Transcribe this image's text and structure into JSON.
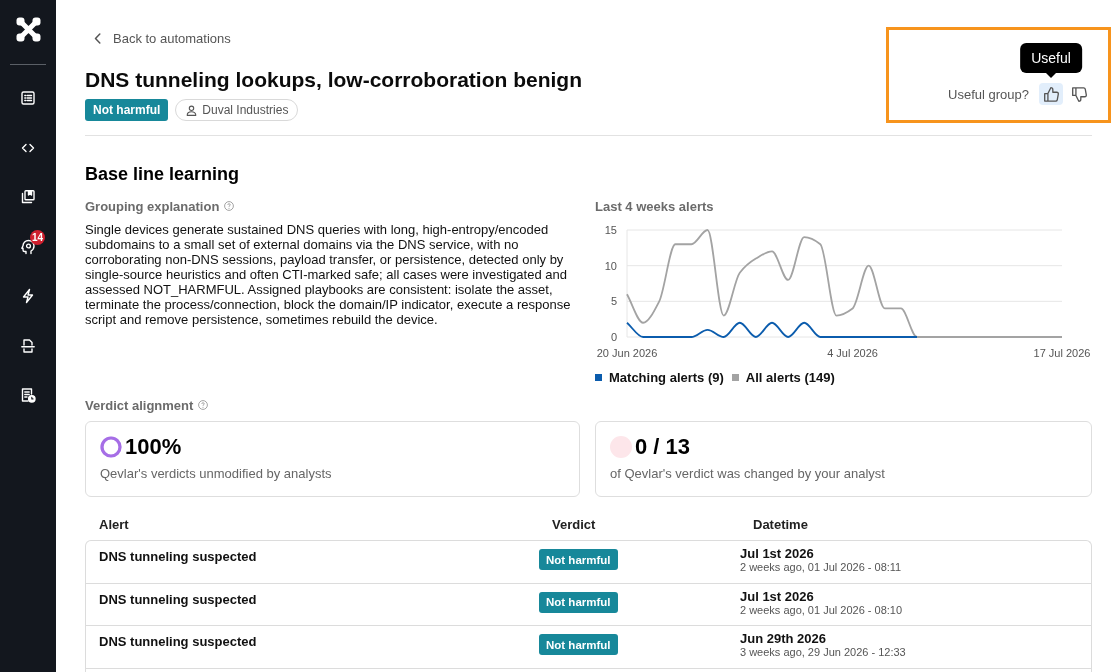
{
  "sidebar": {
    "items": [
      {
        "kind": "list"
      },
      {
        "kind": "code"
      },
      {
        "kind": "library"
      },
      {
        "kind": "head",
        "badge": "14"
      },
      {
        "kind": "bolt"
      },
      {
        "kind": "scan"
      },
      {
        "kind": "report"
      }
    ]
  },
  "header": {
    "back_link": "Back to automations",
    "title": "DNS tunneling lookups, low-corroboration benign",
    "tags": [
      {
        "kind": "verdict",
        "label": "Not harmful"
      },
      {
        "kind": "client",
        "label": "Duval Industries"
      }
    ]
  },
  "feedback": {
    "highlighted": true,
    "label": "Useful group?",
    "buttons": [
      {
        "kind": "up",
        "selected": true,
        "tooltip": "Useful"
      },
      {
        "kind": "down",
        "selected": false
      }
    ]
  },
  "section": {
    "title": "Base line learning",
    "explanation": {
      "label": "Grouping explanation",
      "text": "Single devices generate sustained DNS queries with long, high-entropy/encoded subdomains to a small set of external domains via the DNS service, with no corroborating non-DNS sessions, payload transfer, or persistence, detected only by single-source heuristics and often CTI-marked safe; all cases were investigated and assessed NOT_HARMFUL. Assigned playbooks are consistent: isolate the asset, terminate the process/connection, block the domain/IP indicator, execute a response script and remove persistence, sometimes rebuild the device."
    },
    "chart": {
      "chart_data": {
        "type": "line",
        "title": "Last 4 weeks alerts",
        "categories": [
          "20 Jun 2026",
          null,
          null,
          null,
          null,
          null,
          null,
          null,
          null,
          null,
          null,
          null,
          null,
          null,
          "4 Jul 2026",
          null,
          null,
          null,
          null,
          null,
          null,
          null,
          null,
          null,
          null,
          null,
          null,
          "17 Jul 2026"
        ],
        "ylim": [
          0,
          15
        ],
        "yticks": [
          0,
          5,
          10,
          15
        ],
        "series": [
          {
            "name": "Matching alerts (9)",
            "color": "#0b5cad",
            "values": [
              2,
              0,
              0,
              0,
              0,
              1,
              0,
              2,
              0,
              2,
              0,
              2,
              0,
              0,
              0,
              0,
              0,
              0,
              0,
              null,
              null,
              null,
              null,
              null,
              null,
              null,
              null,
              null
            ]
          },
          {
            "name": "All alerts (149)",
            "color": "#a3a3a3",
            "values": [
              6,
              2,
              5,
              13,
              13,
              15,
              3,
              9,
              11,
              12,
              8,
              14,
              13,
              3,
              4,
              10,
              4,
              4,
              0,
              0,
              0,
              0,
              0,
              0,
              0,
              0,
              0,
              0
            ]
          }
        ]
      }
    }
  },
  "verdict_alignment": {
    "label": "Verdict alignment",
    "cards": [
      {
        "kind": "ring",
        "level": 1,
        "value": "100%",
        "caption": "Qevlar's verdicts unmodified by analysts"
      },
      {
        "kind": "pie",
        "level": 0,
        "value": "0 / 13",
        "caption": "of Qevlar's verdict was changed by your analyst"
      }
    ]
  },
  "table": {
    "columns": [
      "Alert",
      "Verdict",
      "Datetime"
    ],
    "rows": [
      {
        "alert": "DNS tunneling suspected",
        "verdict": "Not harmful",
        "date": "Jul 1st 2026",
        "date_detail": "2 weeks ago, 01 Jul 2026 - 08:11"
      },
      {
        "alert": "DNS tunneling suspected",
        "verdict": "Not harmful",
        "date": "Jul 1st 2026",
        "date_detail": "2 weeks ago, 01 Jul 2026 - 08:10"
      },
      {
        "alert": "DNS tunneling suspected",
        "verdict": "Not harmful",
        "date": "Jun 29th 2026",
        "date_detail": "3 weeks ago, 29 Jun 2026 - 12:33"
      }
    ]
  }
}
